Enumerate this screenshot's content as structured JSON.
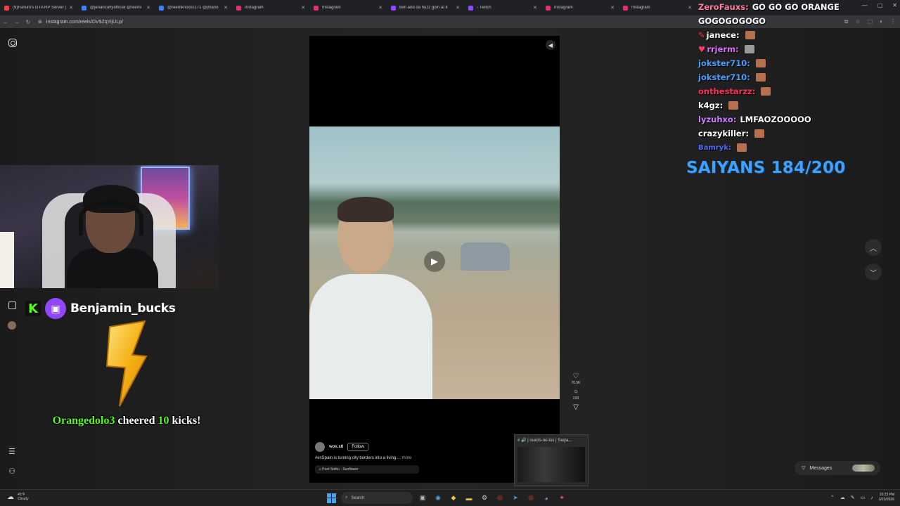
{
  "browser": {
    "tabs": [
      {
        "label": "(9)Fanum's GTA RP Server |",
        "color": "#e44"
      },
      {
        "label": "@jenancurlyofficial @reemi",
        "color": "#3b82f6"
      },
      {
        "label": "@reemknocks171 @jmano",
        "color": "#3b82f6"
      },
      {
        "label": "Instagram",
        "color": "#e1306c"
      },
      {
        "label": "Instagram",
        "color": "#e1306c"
      },
      {
        "label": "ben and da huzz goin at it",
        "color": "#9146ff"
      },
      {
        "label": "- Twitch",
        "color": "#9146ff"
      },
      {
        "label": "Instagram",
        "color": "#e1306c"
      },
      {
        "label": "Instagram",
        "color": "#e1306c"
      }
    ],
    "url": "instagram.com/reels/DV9ZqYijULp/"
  },
  "stream": {
    "streamer_name": "Benjamin_bucks",
    "cheer_user": "Orangedolo3",
    "cheer_text": "cheered",
    "cheer_amount": "10",
    "cheer_unit": "kicks!"
  },
  "reel": {
    "author": "wox.stl",
    "follow_label": "Follow",
    "caption": "#esSpain is turning city borders into a living ...",
    "more_label": "more",
    "music": "♫ Peet Sothu · Sunflower",
    "likes": "70.5K",
    "comments": "233"
  },
  "chat": {
    "messages": [
      {
        "user": "ZeroFauxs:",
        "text": "GO GO GO ORANGE",
        "color": "#ff7fa3",
        "emote": false
      },
      {
        "user": "",
        "text": "GOGOGOGOGO",
        "color": "#ffffff",
        "emote": false
      },
      {
        "user": "janece:",
        "text": "",
        "color": "#ffffff",
        "emote": true
      },
      {
        "user": "rrjerm:",
        "text": "",
        "color": "#e06bff",
        "emote": true
      },
      {
        "user": "jokster710:",
        "text": "",
        "color": "#4a9cff",
        "emote": true
      },
      {
        "user": "jokster710:",
        "text": "",
        "color": "#4a9cff",
        "emote": true
      },
      {
        "user": "onthestarzz:",
        "text": "",
        "color": "#ff2d55",
        "emote": true
      },
      {
        "user": "k4gz:",
        "text": "",
        "color": "#ffffff",
        "emote": true
      },
      {
        "user": "lyzuhxo:",
        "text": "LMFAOZOOOOO",
        "color": "#c77dff",
        "emote": false
      },
      {
        "user": "crazykiller:",
        "text": "",
        "color": "#ffffff",
        "emote": true
      },
      {
        "user": "Bamryk:",
        "text": "",
        "color": "#4a6cff",
        "emote": true
      }
    ],
    "goal": "SAIYANS 184/200"
  },
  "preview": {
    "title": "# 🔊 | reacts-no-tos | Saiya..."
  },
  "messages_pill": {
    "label": "Messages"
  },
  "taskbar": {
    "temp": "45°F",
    "weather": "Cloudy",
    "search_placeholder": "Search",
    "time": "10:23 PM",
    "date": "3/23/2026"
  }
}
